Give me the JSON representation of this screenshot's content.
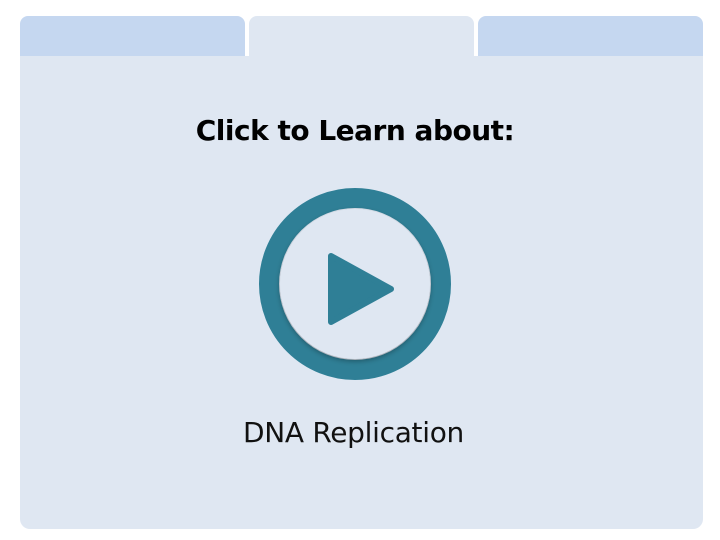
{
  "heading": "Click to Learn about:",
  "topic": "DNA Replication",
  "play_icon": "play-circle-icon",
  "colors": {
    "accent": "#2f7f96",
    "tab_inactive": "#c5d7f0",
    "panel": "#dfe7f2"
  }
}
